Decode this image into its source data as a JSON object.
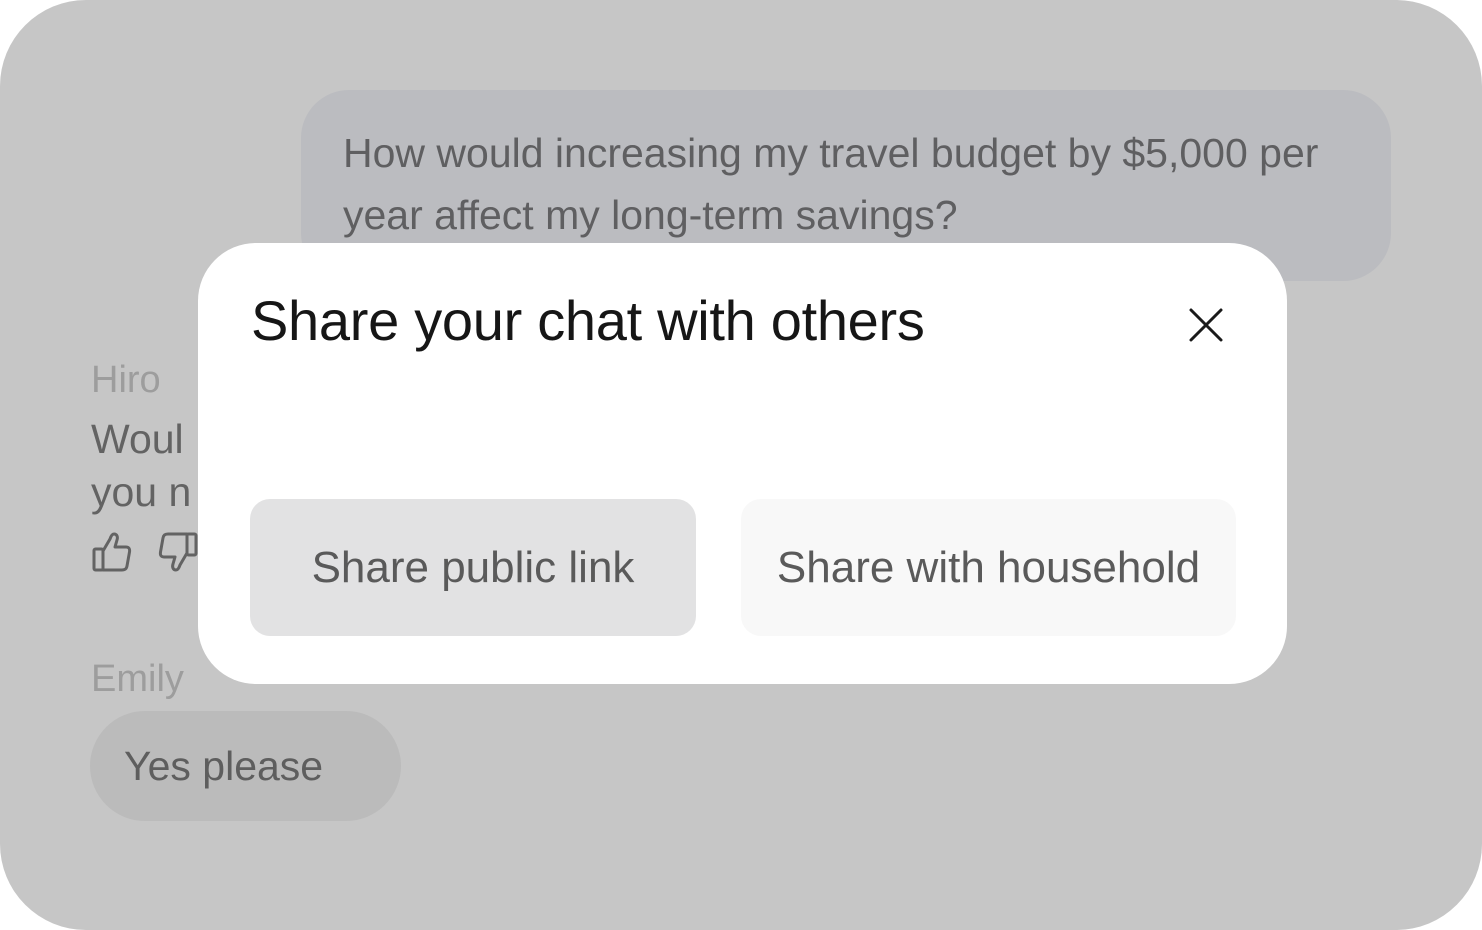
{
  "chat": {
    "user_message": "How would increasing my travel budget by $5,000 per year affect my long-term savings?",
    "assistant": {
      "sender": "Hiro",
      "message_visible": "Woul\nyou n",
      "icons": [
        "thumbs-up-icon",
        "thumbs-down-icon"
      ]
    },
    "reply": {
      "sender": "Emily",
      "message": "Yes please"
    }
  },
  "modal": {
    "title": "Share your chat with others",
    "close_icon": "close-icon",
    "buttons": {
      "public_link": "Share public link",
      "household": "Share with household"
    }
  },
  "colors": {
    "backdrop": "#c6c6c6",
    "user_bubble": "#bbbcc0",
    "modal_bg": "#ffffff",
    "primary_button": "#e2e2e3",
    "secondary_button": "#f8f8f8",
    "title_text": "#161616"
  }
}
